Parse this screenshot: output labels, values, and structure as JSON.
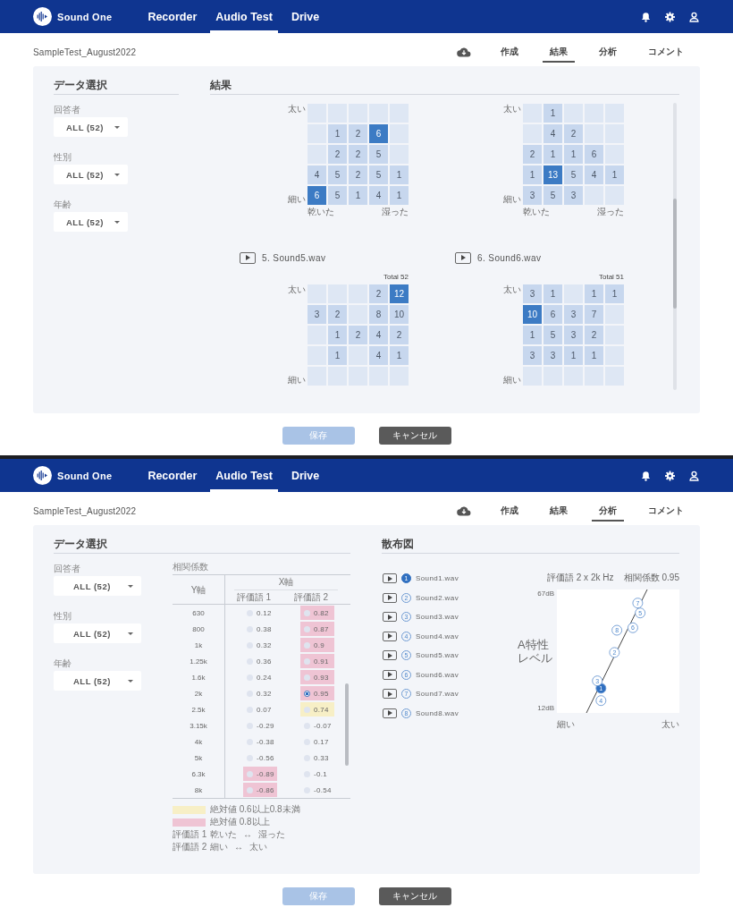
{
  "screens": [
    {
      "app_bar": {
        "brand": "Sound One",
        "nav": [
          {
            "label": "Recorder",
            "selected": false
          },
          {
            "label": "Audio Test",
            "selected": true
          },
          {
            "label": "Drive",
            "selected": false
          }
        ]
      },
      "document_title": "SampleTest_August2022",
      "view_tabs": [
        {
          "label": "作成",
          "selected": false
        },
        {
          "label": "結果",
          "selected": true
        },
        {
          "label": "分析",
          "selected": false
        },
        {
          "label": "コメント",
          "selected": false
        }
      ],
      "panel": {
        "kind": "results",
        "data_select": {
          "heading": "データ選択",
          "filters": [
            {
              "label": "回答者",
              "value": "ALL (52)"
            },
            {
              "label": "性別",
              "value": "ALL (52)"
            },
            {
              "label": "年齢",
              "value": "ALL (52)"
            }
          ]
        },
        "heading": "結果",
        "grids": [
          {
            "top_label": "太い",
            "bottom_label": "細い",
            "left_label": "乾いた",
            "right_label": "湿った",
            "rows": [
              [
                {
                  "highlighted": false
                },
                {
                  "highlighted": false
                },
                {
                  "highlighted": false
                },
                {
                  "highlighted": false
                },
                {
                  "highlighted": false
                }
              ],
              [
                {
                  "highlighted": false
                },
                {
                  "value": "1",
                  "highlighted": false
                },
                {
                  "value": "2",
                  "highlighted": false
                },
                {
                  "value": "6",
                  "highlighted": true
                },
                {
                  "highlighted": false
                }
              ],
              [
                {
                  "highlighted": false
                },
                {
                  "value": "2",
                  "highlighted": false
                },
                {
                  "value": "2",
                  "highlighted": false
                },
                {
                  "value": "5",
                  "highlighted": false
                },
                {
                  "highlighted": false
                }
              ],
              [
                {
                  "value": "4",
                  "highlighted": false
                },
                {
                  "value": "5",
                  "highlighted": false
                },
                {
                  "value": "2",
                  "highlighted": false
                },
                {
                  "value": "5",
                  "highlighted": false
                },
                {
                  "value": "1",
                  "highlighted": false
                }
              ],
              [
                {
                  "value": "6",
                  "highlighted": true
                },
                {
                  "value": "5",
                  "highlighted": false
                },
                {
                  "value": "1",
                  "highlighted": false
                },
                {
                  "value": "4",
                  "highlighted": false
                },
                {
                  "value": "1",
                  "highlighted": false
                }
              ]
            ]
          },
          {
            "top_label": "太い",
            "bottom_label": "細い",
            "left_label": "乾いた",
            "right_label": "湿った",
            "rows": [
              [
                {
                  "highlighted": false
                },
                {
                  "value": "1",
                  "highlighted": false
                },
                {
                  "highlighted": false
                },
                {
                  "highlighted": false
                },
                {
                  "highlighted": false
                }
              ],
              [
                {
                  "highlighted": false
                },
                {
                  "value": "4",
                  "highlighted": false
                },
                {
                  "value": "2",
                  "highlighted": false
                },
                {
                  "highlighted": false
                },
                {
                  "highlighted": false
                }
              ],
              [
                {
                  "value": "2",
                  "highlighted": false
                },
                {
                  "value": "1",
                  "highlighted": false
                },
                {
                  "value": "1",
                  "highlighted": false
                },
                {
                  "value": "6",
                  "highlighted": false
                },
                {
                  "highlighted": false
                }
              ],
              [
                {
                  "value": "1",
                  "highlighted": false
                },
                {
                  "value": "13",
                  "highlighted": true
                },
                {
                  "value": "5",
                  "highlighted": false
                },
                {
                  "value": "4",
                  "highlighted": false
                },
                {
                  "value": "1",
                  "highlighted": false
                }
              ],
              [
                {
                  "value": "3",
                  "highlighted": false
                },
                {
                  "value": "5",
                  "highlighted": false
                },
                {
                  "value": "3",
                  "highlighted": false
                },
                {
                  "highlighted": false
                },
                {
                  "highlighted": false
                }
              ]
            ]
          },
          {
            "title": "5. Sound5.wav",
            "total": "Total 52",
            "top_label": "太い",
            "bottom_label": "細い",
            "rows": [
              [
                {
                  "highlighted": false
                },
                {
                  "highlighted": false
                },
                {
                  "highlighted": false
                },
                {
                  "value": "2",
                  "highlighted": false
                },
                {
                  "value": "12",
                  "highlighted": true
                }
              ],
              [
                {
                  "value": "3",
                  "highlighted": false
                },
                {
                  "value": "2",
                  "highlighted": false
                },
                {
                  "highlighted": false
                },
                {
                  "value": "8",
                  "highlighted": false
                },
                {
                  "value": "10",
                  "highlighted": false
                }
              ],
              [
                {
                  "highlighted": false
                },
                {
                  "value": "1",
                  "highlighted": false
                },
                {
                  "value": "2",
                  "highlighted": false
                },
                {
                  "value": "4",
                  "highlighted": false
                },
                {
                  "value": "2",
                  "highlighted": false
                }
              ],
              [
                {
                  "highlighted": false
                },
                {
                  "value": "1",
                  "highlighted": false
                },
                {
                  "highlighted": false
                },
                {
                  "value": "4",
                  "highlighted": false
                },
                {
                  "value": "1",
                  "highlighted": false
                }
              ],
              [
                {
                  "highlighted": false
                },
                {
                  "highlighted": false
                },
                {
                  "highlighted": false
                },
                {
                  "highlighted": false
                },
                {
                  "highlighted": false
                }
              ]
            ]
          },
          {
            "title": "6. Sound6.wav",
            "total": "Total 51",
            "top_label": "太い",
            "bottom_label": "細い",
            "rows": [
              [
                {
                  "value": "3",
                  "highlighted": false
                },
                {
                  "value": "1",
                  "highlighted": false
                },
                {
                  "highlighted": false
                },
                {
                  "value": "1",
                  "highlighted": false
                },
                {
                  "value": "1",
                  "highlighted": false
                }
              ],
              [
                {
                  "value": "10",
                  "highlighted": true
                },
                {
                  "value": "6",
                  "highlighted": false
                },
                {
                  "value": "3",
                  "highlighted": false
                },
                {
                  "value": "7",
                  "highlighted": false
                },
                {
                  "highlighted": false
                }
              ],
              [
                {
                  "value": "1",
                  "highlighted": false
                },
                {
                  "value": "5",
                  "highlighted": false
                },
                {
                  "value": "3",
                  "highlighted": false
                },
                {
                  "value": "2",
                  "highlighted": false
                },
                {
                  "highlighted": false
                }
              ],
              [
                {
                  "value": "3",
                  "highlighted": false
                },
                {
                  "value": "3",
                  "highlighted": false
                },
                {
                  "value": "1",
                  "highlighted": false
                },
                {
                  "value": "1",
                  "highlighted": false
                },
                {
                  "highlighted": false
                }
              ],
              [
                {
                  "highlighted": false
                },
                {
                  "highlighted": false
                },
                {
                  "highlighted": false
                },
                {
                  "highlighted": false
                },
                {
                  "highlighted": false
                }
              ]
            ]
          }
        ]
      },
      "buttons": [
        {
          "kind": "save",
          "label": "保存",
          "disabled": true
        },
        {
          "kind": "cancel",
          "label": "キャンセル",
          "disabled": false
        }
      ]
    },
    {
      "app_bar": {
        "brand": "Sound One",
        "nav": [
          {
            "label": "Recorder",
            "selected": false
          },
          {
            "label": "Audio Test",
            "selected": true
          },
          {
            "label": "Drive",
            "selected": false
          }
        ]
      },
      "document_title": "SampleTest_August2022",
      "view_tabs": [
        {
          "label": "作成",
          "selected": false
        },
        {
          "label": "結果",
          "selected": false
        },
        {
          "label": "分析",
          "selected": true
        },
        {
          "label": "コメント",
          "selected": false
        }
      ],
      "panel": {
        "kind": "analysis",
        "data_select": {
          "heading": "データ選択",
          "filters": [
            {
              "label": "回答者",
              "value": "ALL (52)"
            },
            {
              "label": "性別",
              "value": "ALL (52)"
            },
            {
              "label": "年齢",
              "value": "ALL (52)"
            }
          ]
        },
        "correlation": {
          "caption": "相関係数",
          "y_header": "Y軸",
          "x_header": "X軸",
          "columns": [
            "評価語 1",
            "評価語 2"
          ],
          "rows": [
            {
              "label": "630",
              "cells": [
                {
                  "value": "0.12",
                  "selected": false
                },
                {
                  "value": "0.82",
                  "color": "#efc4d4",
                  "selected": false
                }
              ]
            },
            {
              "label": "800",
              "cells": [
                {
                  "value": "0.38",
                  "selected": false
                },
                {
                  "value": "0.87",
                  "color": "#efc4d4",
                  "selected": false
                }
              ]
            },
            {
              "label": "1k",
              "cells": [
                {
                  "value": "0.32",
                  "selected": false
                },
                {
                  "value": "0.9",
                  "color": "#efc4d4",
                  "selected": false
                }
              ]
            },
            {
              "label": "1.25k",
              "cells": [
                {
                  "value": "0.36",
                  "selected": false
                },
                {
                  "value": "0.91",
                  "color": "#efc4d4",
                  "selected": false
                }
              ]
            },
            {
              "label": "1.6k",
              "cells": [
                {
                  "value": "0.24",
                  "selected": false
                },
                {
                  "value": "0.93",
                  "color": "#efc4d4",
                  "selected": false
                }
              ]
            },
            {
              "label": "2k",
              "cells": [
                {
                  "value": "0.32",
                  "selected": false
                },
                {
                  "value": "0.95",
                  "color": "#efc4d4",
                  "selected": true
                }
              ]
            },
            {
              "label": "2.5k",
              "cells": [
                {
                  "value": "0.07",
                  "selected": false
                },
                {
                  "value": "0.74",
                  "color": "#f7efc6",
                  "selected": false
                }
              ]
            },
            {
              "label": "3.15k",
              "cells": [
                {
                  "value": "-0.29",
                  "selected": false
                },
                {
                  "value": "-0.07",
                  "selected": false
                }
              ]
            },
            {
              "label": "4k",
              "cells": [
                {
                  "value": "-0.38",
                  "selected": false
                },
                {
                  "value": "0.17",
                  "selected": false
                }
              ]
            },
            {
              "label": "5k",
              "cells": [
                {
                  "value": "-0.56",
                  "selected": false
                },
                {
                  "value": "0.33",
                  "selected": false
                }
              ]
            },
            {
              "label": "6.3k",
              "cells": [
                {
                  "value": "-0.89",
                  "color": "#efc4d4",
                  "selected": false
                },
                {
                  "value": "-0.1",
                  "selected": false
                }
              ]
            },
            {
              "label": "8k",
              "cells": [
                {
                  "value": "-0.86",
                  "color": "#efc4d4",
                  "selected": false
                },
                {
                  "value": "-0.54",
                  "selected": false
                }
              ]
            }
          ]
        },
        "legend": {
          "bands": [
            {
              "color": "#f7efc6",
              "text": "絶対値 0.6以上0.8未満"
            },
            {
              "color": "#efc4d4",
              "text": "絶対値 0.8以上"
            }
          ],
          "scales": [
            {
              "term": "評価語 1",
              "left": "乾いた",
              "arrow": "↔",
              "right": "湿った"
            },
            {
              "term": "評価語 2",
              "left": "細い",
              "arrow": "↔",
              "right": "太い"
            }
          ]
        },
        "scatter": {
          "heading": "散布図",
          "sounds": [
            {
              "number": "1",
              "name": "Sound1.wav",
              "selected": true
            },
            {
              "number": "2",
              "name": "Sound2.wav",
              "selected": false
            },
            {
              "number": "3",
              "name": "Sound3.wav",
              "selected": false
            },
            {
              "number": "4",
              "name": "Sound4.wav",
              "selected": false
            },
            {
              "number": "5",
              "name": "Sound5.wav",
              "selected": false
            },
            {
              "number": "6",
              "name": "Sound6.wav",
              "selected": false
            },
            {
              "number": "7",
              "name": "Sound7.wav",
              "selected": false
            },
            {
              "number": "8",
              "name": "Sound8.wav",
              "selected": false
            }
          ],
          "plot": {
            "title": "評価語 2 x 2k Hz",
            "correlation": "相関係数 0.95",
            "y_max": "67dB",
            "y_min": "12dB",
            "y_label": "A特性レベル",
            "x_min": "細い",
            "x_max": "太い",
            "points": [
              {
                "label": "1",
                "selected": true
              },
              {
                "label": "2",
                "selected": false
              },
              {
                "label": "3",
                "selected": false
              },
              {
                "label": "4",
                "selected": false
              },
              {
                "label": "5",
                "selected": false
              },
              {
                "label": "6",
                "selected": false
              },
              {
                "label": "7",
                "selected": false
              },
              {
                "label": "8",
                "selected": false
              }
            ]
          }
        }
      },
      "buttons": [
        {
          "kind": "save",
          "label": "保存",
          "disabled": true
        },
        {
          "kind": "cancel",
          "label": "キャンセル",
          "disabled": false
        }
      ]
    }
  ]
}
